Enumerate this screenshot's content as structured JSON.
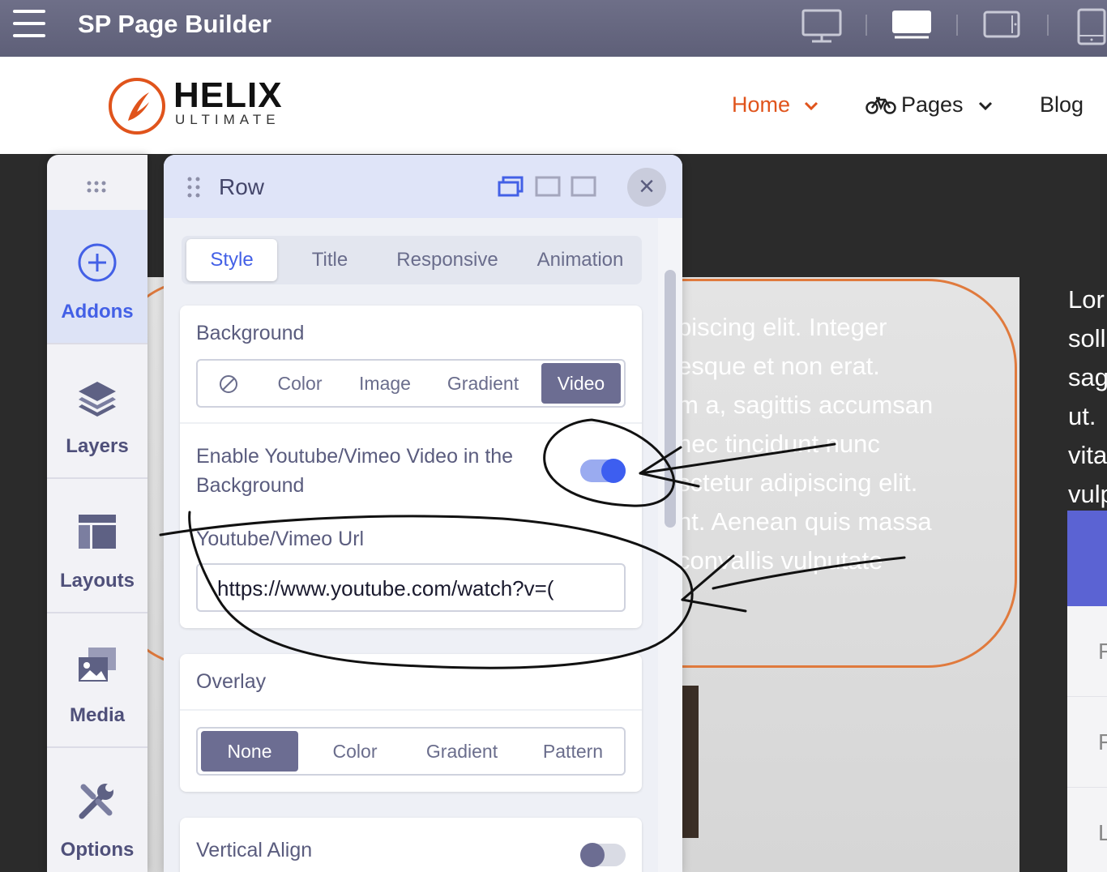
{
  "app": {
    "title": "SP Page Builder"
  },
  "devices": [
    "desktop-icon",
    "laptop-icon",
    "tablet-landscape-icon",
    "tablet-portrait-icon"
  ],
  "site": {
    "logo": {
      "name": "HELIX",
      "sub": "ULTIMATE"
    },
    "nav": [
      {
        "label": "Home",
        "active": true
      },
      {
        "label": "Pages"
      },
      {
        "label": "Blog"
      }
    ]
  },
  "background_text": {
    "lines": [
      "piscing elit. Integer",
      "esque et non erat.",
      "m a, sagittis accumsan",
      "nec tincidunt nunc",
      "sctetur adipiscing elit.",
      "nt. Aenean quis massa",
      "convallis vulputate"
    ],
    "right_lines": [
      "Lor",
      "soll",
      "sag",
      "ut.",
      "vita",
      "vulp"
    ],
    "list_letters": [
      "F",
      "F",
      "L"
    ]
  },
  "sidebar": {
    "items": [
      {
        "label": "Addons",
        "icon": "plus-circle-icon",
        "active": true
      },
      {
        "label": "Layers",
        "icon": "layers-icon"
      },
      {
        "label": "Layouts",
        "icon": "layout-icon"
      },
      {
        "label": "Media",
        "icon": "media-icon"
      },
      {
        "label": "Options",
        "icon": "tools-icon"
      }
    ]
  },
  "panel": {
    "title": "Row",
    "tabs": [
      {
        "label": "Style",
        "active": true
      },
      {
        "label": "Title"
      },
      {
        "label": "Responsive"
      },
      {
        "label": "Animation"
      }
    ],
    "background": {
      "label": "Background",
      "options": [
        "none-icon",
        "Color",
        "Image",
        "Gradient",
        "Video"
      ],
      "selected": "Video"
    },
    "video_toggle": {
      "label": "Enable Youtube/Vimeo Video in the Background",
      "enabled": true
    },
    "url": {
      "label": "Youtube/Vimeo Url",
      "value": "https://www.youtube.com/watch?v=( "
    },
    "overlay": {
      "label": "Overlay",
      "options": [
        "None",
        "Color",
        "Gradient",
        "Pattern"
      ],
      "selected": "None"
    },
    "vertical_align": {
      "label": "Vertical Align",
      "enabled": false
    }
  },
  "colors": {
    "accent": "#4360e6",
    "nav_active": "#e0541c",
    "segment_active": "#6c6d92",
    "topbar": "#66677f"
  }
}
